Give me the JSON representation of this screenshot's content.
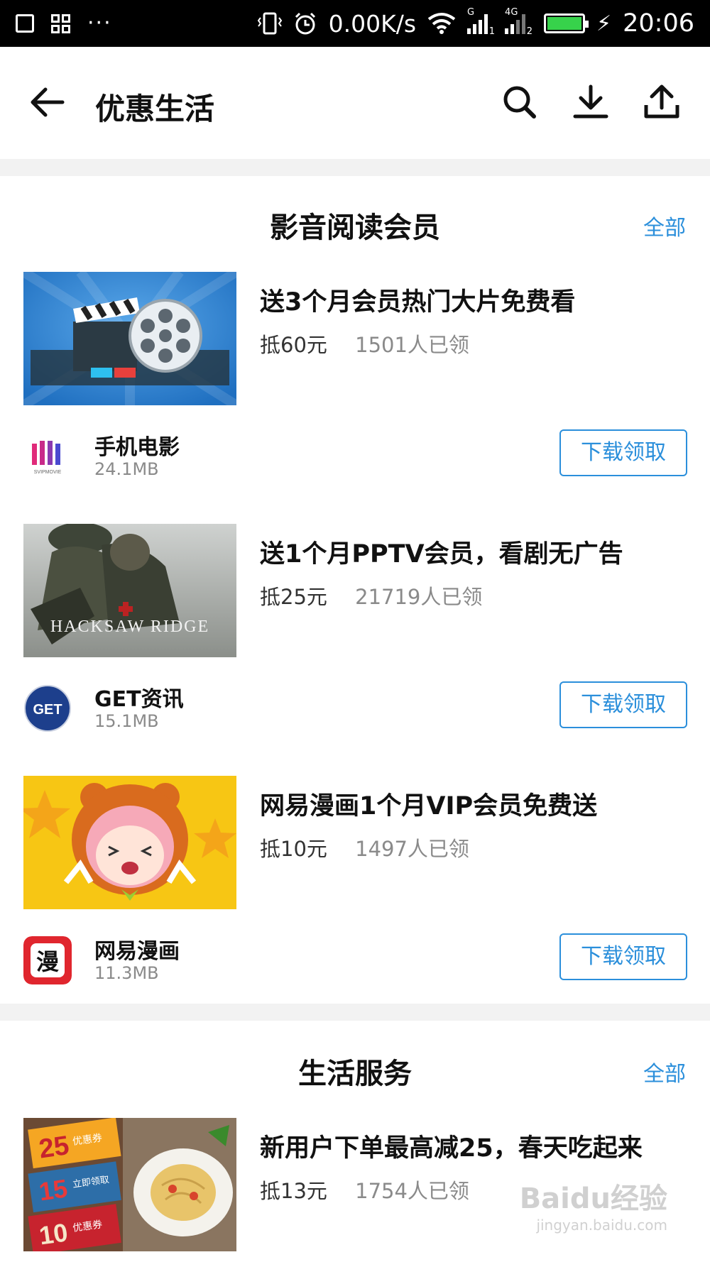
{
  "status_bar": {
    "speed": "0.00K/s",
    "sim1": "G",
    "sim2": "4G",
    "sim1_index": "1",
    "sim2_index": "2",
    "time": "20:06",
    "battery_color": "#37d24b"
  },
  "header": {
    "title": "优惠生活"
  },
  "sections": [
    {
      "title": "影音阅读会员",
      "all_label": "全部",
      "offers": [
        {
          "title": "送3个月会员热门大片免费看",
          "value": "抵60元",
          "count": "1501人已领",
          "app_name": "手机电影",
          "app_size": "24.1MB",
          "app_icon_text": "SVIPMOVIE",
          "button": "下载领取",
          "thumb_icon": "movie-clapper-reel-image"
        },
        {
          "title": "送1个月PPTV会员，看剧无广告",
          "value": "抵25元",
          "count": "21719人已领",
          "app_name": "GET资讯",
          "app_size": "15.1MB",
          "app_icon_text": "GET",
          "button": "下载领取",
          "thumb_text": "HACKSAW RIDGE",
          "thumb_icon": "hacksaw-ridge-poster-image"
        },
        {
          "title": "网易漫画1个月VIP会员免费送",
          "value": "抵10元",
          "count": "1497人已领",
          "app_name": "网易漫画",
          "app_size": "11.3MB",
          "app_icon_text": "漫",
          "button": "下载领取",
          "thumb_icon": "anime-girl-bear-hood-image"
        }
      ]
    },
    {
      "title": "生活服务",
      "all_label": "全部",
      "offers": [
        {
          "title": "新用户下单最高减25，春天吃起来",
          "value": "抵13元",
          "count": "1754人已领",
          "thumb_icon": "coupon-pasta-image",
          "coupon_texts": [
            "25",
            "15",
            "10",
            "优惠券",
            "立即领取"
          ]
        }
      ]
    }
  ],
  "watermark": {
    "brand": "Baidu经验",
    "url": "jingyan.baidu.com"
  },
  "colors": {
    "accent": "#2b8fdb",
    "background": "#f2f2f2"
  }
}
